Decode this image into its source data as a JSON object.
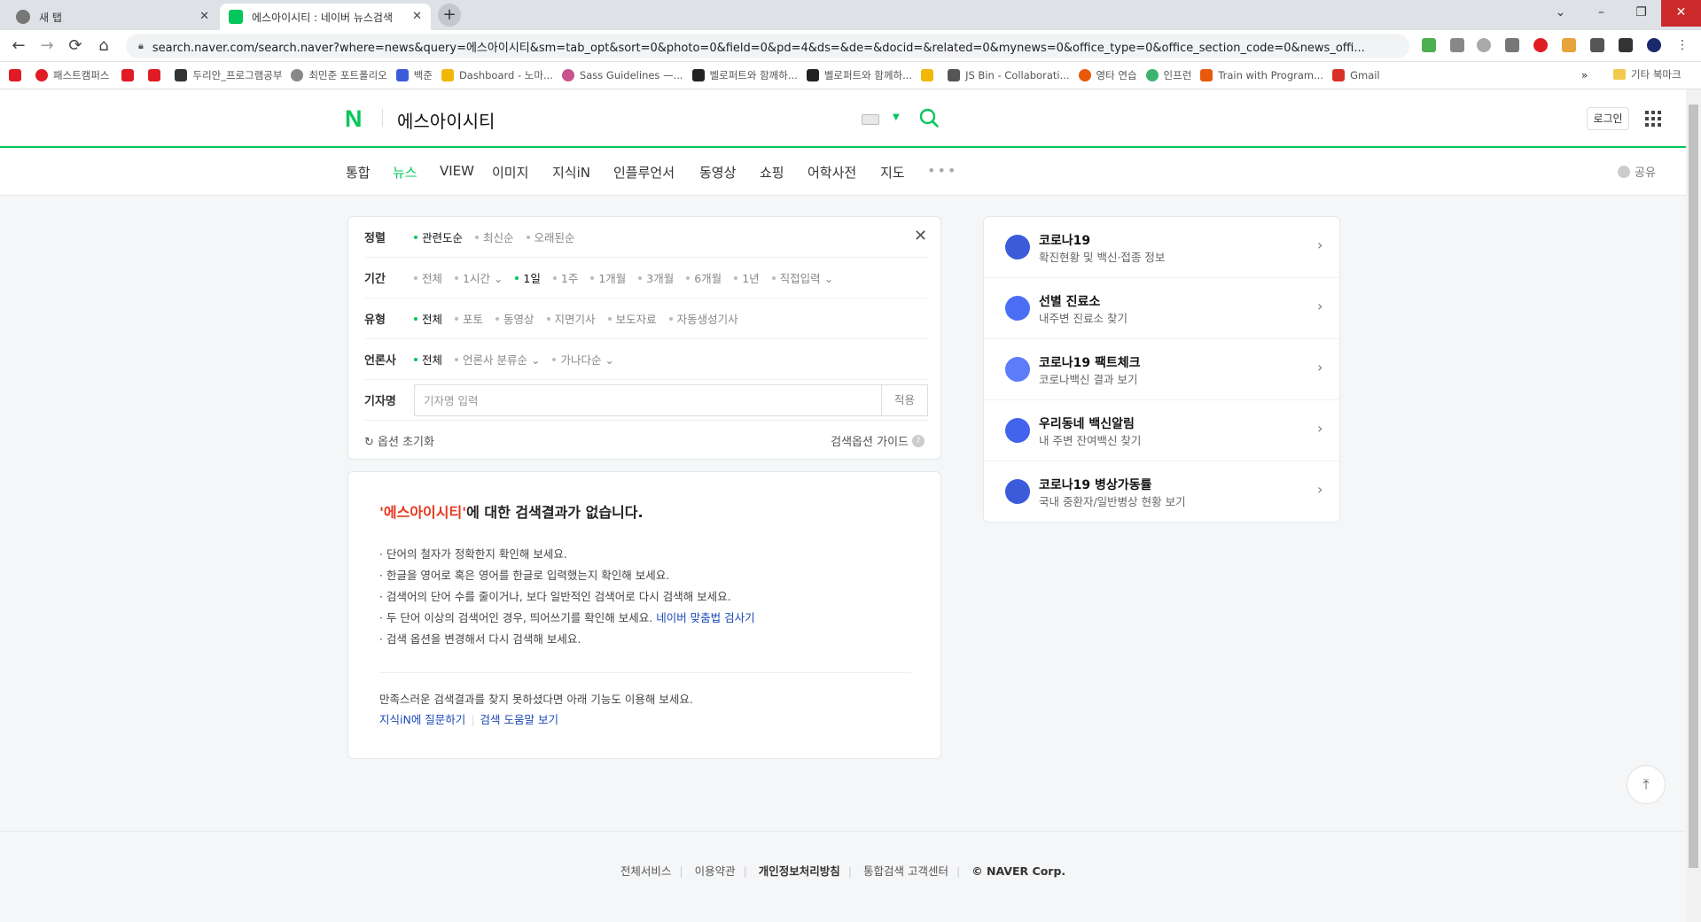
{
  "browser": {
    "tabs": [
      {
        "title": "새 탭",
        "active": false
      },
      {
        "title": "에스아이시티 : 네이버 뉴스검색",
        "active": true
      }
    ],
    "new_tab": "+",
    "window_controls": {
      "tabsearch": "⌄",
      "minimize": "–",
      "restore": "❐",
      "close": "✕"
    },
    "url": "search.naver.com/search.naver?where=news&query=에스아이시티&sm=tab_opt&sort=0&photo=0&field=0&pd=4&ds=&de=&docid=&related=0&mynews=0&office_type=0&office_section_code=0&news_offi...",
    "nav": {
      "back": "←",
      "forward": "→",
      "reload": "⟳",
      "home": "⌂"
    },
    "bookmarks": [
      {
        "label": "패스트캠퍼스",
        "color": "#e01b24"
      },
      {
        "label": "",
        "color": "#e01b24"
      },
      {
        "label": "",
        "color": "#e01b24"
      },
      {
        "label": "두리안_프로그램공부",
        "color": "#333333"
      },
      {
        "label": "최민준 포트폴리오",
        "color": "#888888"
      },
      {
        "label": "백준",
        "color": "#3b5bdb"
      },
      {
        "label": "Dashboard - 노마...",
        "color": "#f2b705"
      },
      {
        "label": "Sass Guidelines —...",
        "color": "#c6538c"
      },
      {
        "label": "벨로퍼트와 함께하...",
        "color": "#222222"
      },
      {
        "label": "벨로퍼트와 함께하...",
        "color": "#222222"
      },
      {
        "label": "",
        "color": "#f2b705"
      },
      {
        "label": "JS Bin - Collaborati...",
        "color": "#555555"
      },
      {
        "label": "영타 연습",
        "color": "#e8590c"
      },
      {
        "label": "인프런",
        "color": "#3cb371"
      },
      {
        "label": "Train with Program...",
        "color": "#e8590c"
      },
      {
        "label": "Gmail",
        "color": "#d93025"
      }
    ],
    "bookmarks_more": "»",
    "bookmarks_other": "기타 북마크"
  },
  "header": {
    "logo": "N",
    "query": "에스아이시티",
    "login": "로그인"
  },
  "search_tabs": [
    {
      "label": "통합",
      "active": false
    },
    {
      "label": "뉴스",
      "active": true
    },
    {
      "label": "VIEW",
      "active": false
    },
    {
      "label": "이미지",
      "active": false
    },
    {
      "label": "지식iN",
      "active": false
    },
    {
      "label": "인플루언서",
      "active": false
    },
    {
      "label": "동영상",
      "active": false
    },
    {
      "label": "쇼핑",
      "active": false
    },
    {
      "label": "어학사전",
      "active": false
    },
    {
      "label": "지도",
      "active": false
    }
  ],
  "more_dots": "•••",
  "share": "공유",
  "options": {
    "sort": {
      "label": "정렬",
      "items": [
        {
          "label": "관련도순",
          "on": true
        },
        {
          "label": "최신순",
          "on": false
        },
        {
          "label": "오래된순",
          "on": false
        }
      ]
    },
    "period": {
      "label": "기간",
      "items": [
        {
          "label": "전체",
          "on": false
        },
        {
          "label": "1시간 ⌄",
          "on": false
        },
        {
          "label": "1일",
          "on": true
        },
        {
          "label": "1주",
          "on": false
        },
        {
          "label": "1개월",
          "on": false
        },
        {
          "label": "3개월",
          "on": false
        },
        {
          "label": "6개월",
          "on": false
        },
        {
          "label": "1년",
          "on": false
        },
        {
          "label": "직접입력 ⌄",
          "on": false
        }
      ]
    },
    "type": {
      "label": "유형",
      "items": [
        {
          "label": "전체",
          "on": true
        },
        {
          "label": "포토",
          "on": false
        },
        {
          "label": "동영상",
          "on": false
        },
        {
          "label": "지면기사",
          "on": false
        },
        {
          "label": "보도자료",
          "on": false
        },
        {
          "label": "자동생성기사",
          "on": false
        }
      ]
    },
    "press": {
      "label": "언론사",
      "items": [
        {
          "label": "전체",
          "on": true
        },
        {
          "label": "언론사 분류순 ⌄",
          "on": false
        },
        {
          "label": "가나다순 ⌄",
          "on": false
        }
      ]
    },
    "reporter": {
      "label": "기자명",
      "placeholder": "기자명 입력",
      "apply": "적용"
    },
    "reset": "옵션 초기화",
    "guide": "검색옵션 가이드",
    "close": "✕"
  },
  "no_result": {
    "query_quoted": "'에스아이시티'",
    "title_rest": "에 대한 검색결과가 없습니다.",
    "tips": [
      "· 단어의 철자가 정확한지 확인해 보세요.",
      "· 한글을 영어로 혹은 영어를 한글로 입력했는지 확인해 보세요.",
      "· 검색어의 단어 수를 줄이거나, 보다 일반적인 검색어로 다시 검색해 보세요.",
      "· 두 단어 이상의 검색어인 경우, 띄어쓰기를 확인해 보세요.",
      "· 검색 옵션을 변경해서 다시 검색해 보세요."
    ],
    "spell_link": "네이버 맞춤법 검사기",
    "more_text": "만족스러운 검색결과를 찾지 못하셨다면 아래 기능도 이용해 보세요.",
    "link_ask": "지식iN에 질문하기",
    "link_help": "검색 도움말 보기"
  },
  "covid": [
    {
      "title": "코로나19",
      "sub": "확진현황 및 백신·접종 정보",
      "icon": "covid-icon",
      "color": "#3b5bdb"
    },
    {
      "title": "선별 진료소",
      "sub": "내주변 진료소 찾기",
      "icon": "clinic-pin-icon",
      "color": "#4c6ef5"
    },
    {
      "title": "코로나19 팩트체크",
      "sub": "코로나백신 결과 보기",
      "icon": "factcheck-icon",
      "color": "#5c7cfa"
    },
    {
      "title": "우리동네 백신알림",
      "sub": "내 주변 잔여백신 찾기",
      "icon": "syringe-icon",
      "color": "#4263eb"
    },
    {
      "title": "코로나19 병상가동률",
      "sub": "국내 중환자/일반병상 현황 보기",
      "icon": "hospital-bed-icon",
      "color": "#3b5bdb"
    }
  ],
  "to_top": "⤒",
  "footer": {
    "links": [
      "전체서비스",
      "이용약관",
      "개인정보처리방침",
      "통합검색 고객센터"
    ],
    "copyright": "© NAVER Corp."
  },
  "colors": {
    "brand": "#03c75a",
    "query_red": "#e8371f",
    "link_blue": "#1b47b8"
  }
}
